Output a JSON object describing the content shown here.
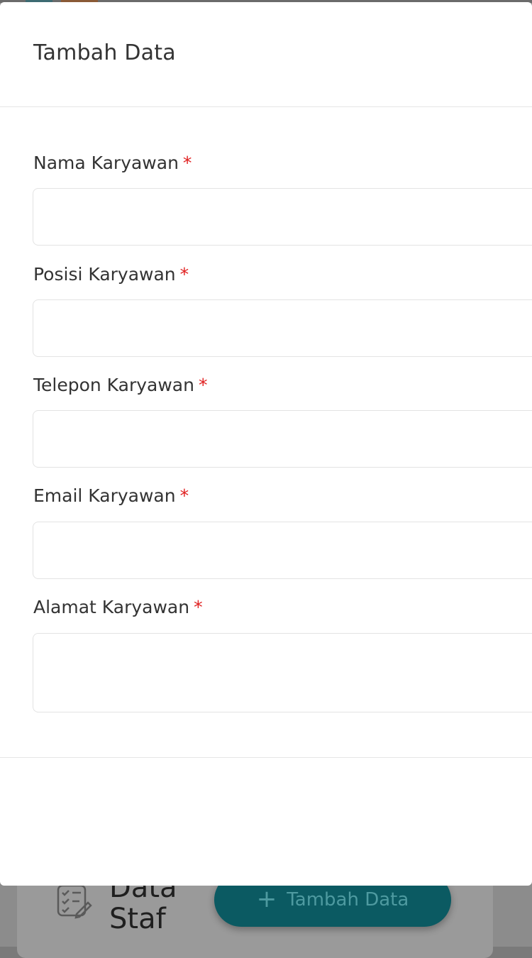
{
  "background": {
    "page_title_line1": "Data",
    "page_title_line2": "Staf",
    "add_button_label": "Tambah Data",
    "add_button_icon": "plus-icon",
    "card_icon": "checklist-edit-icon"
  },
  "modal": {
    "title": "Tambah Data",
    "fields": [
      {
        "label": "Nama Karyawan",
        "required_mark": "*",
        "value": ""
      },
      {
        "label": "Posisi Karyawan",
        "required_mark": "*",
        "value": ""
      },
      {
        "label": "Telepon Karyawan",
        "required_mark": "*",
        "value": ""
      },
      {
        "label": "Email Karyawan",
        "required_mark": "*",
        "value": ""
      },
      {
        "label": "Alamat Karyawan",
        "required_mark": "*",
        "value": ""
      }
    ]
  }
}
